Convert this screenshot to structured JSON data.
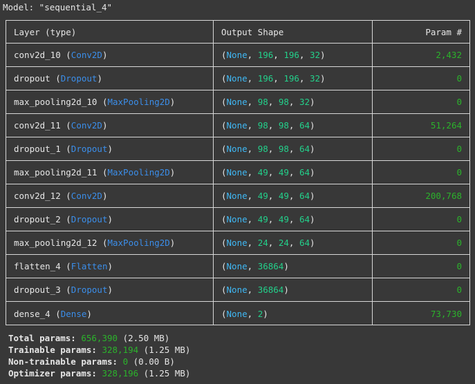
{
  "model_title": "Model: \"sequential_4\"",
  "columns": {
    "layer": "Layer (type)",
    "output": "Output Shape",
    "params": "Param #"
  },
  "rows": [
    {
      "name": "conv2d_10",
      "type": "Conv2D",
      "shape": [
        "None",
        "196",
        "196",
        "32"
      ],
      "params": "2,432"
    },
    {
      "name": "dropout",
      "type": "Dropout",
      "shape": [
        "None",
        "196",
        "196",
        "32"
      ],
      "params": "0"
    },
    {
      "name": "max_pooling2d_10",
      "type": "MaxPooling2D",
      "shape": [
        "None",
        "98",
        "98",
        "32"
      ],
      "params": "0"
    },
    {
      "name": "conv2d_11",
      "type": "Conv2D",
      "shape": [
        "None",
        "98",
        "98",
        "64"
      ],
      "params": "51,264"
    },
    {
      "name": "dropout_1",
      "type": "Dropout",
      "shape": [
        "None",
        "98",
        "98",
        "64"
      ],
      "params": "0"
    },
    {
      "name": "max_pooling2d_11",
      "type": "MaxPooling2D",
      "shape": [
        "None",
        "49",
        "49",
        "64"
      ],
      "params": "0"
    },
    {
      "name": "conv2d_12",
      "type": "Conv2D",
      "shape": [
        "None",
        "49",
        "49",
        "64"
      ],
      "params": "200,768"
    },
    {
      "name": "dropout_2",
      "type": "Dropout",
      "shape": [
        "None",
        "49",
        "49",
        "64"
      ],
      "params": "0"
    },
    {
      "name": "max_pooling2d_12",
      "type": "MaxPooling2D",
      "shape": [
        "None",
        "24",
        "24",
        "64"
      ],
      "params": "0"
    },
    {
      "name": "flatten_4",
      "type": "Flatten",
      "shape": [
        "None",
        "36864"
      ],
      "params": "0"
    },
    {
      "name": "dropout_3",
      "type": "Dropout",
      "shape": [
        "None",
        "36864"
      ],
      "params": "0"
    },
    {
      "name": "dense_4",
      "type": "Dense",
      "shape": [
        "None",
        "2"
      ],
      "params": "73,730"
    }
  ],
  "footer": [
    {
      "label": "Total params:",
      "value": "656,390",
      "note": "(2.50 MB)"
    },
    {
      "label": "Trainable params:",
      "value": "328,194",
      "note": "(1.25 MB)"
    },
    {
      "label": "Non-trainable params:",
      "value": "0",
      "note": "(0.00 B)"
    },
    {
      "label": "Optimizer params:",
      "value": "328,196",
      "note": "(1.25 MB)"
    }
  ],
  "colors": {
    "background": "#383838",
    "layer_class": "#3b8eea",
    "none_keyword": "#3fb8f5",
    "dims": "#23d18b",
    "param_numbers": "#2bb32b"
  }
}
